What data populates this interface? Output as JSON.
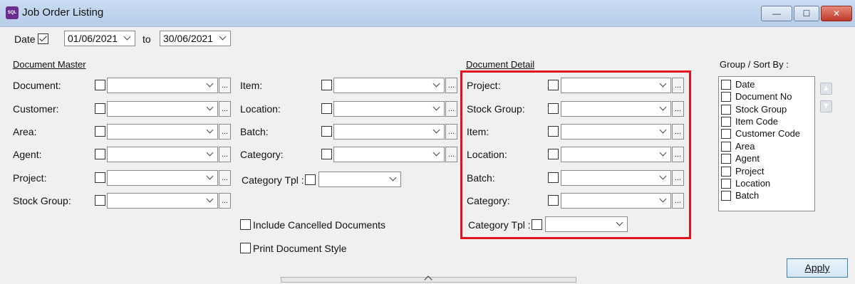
{
  "window": {
    "app_icon_text": "SQL",
    "title": "Job Order Listing",
    "minimize_glyph": "—",
    "maximize_glyph": "☐",
    "close_glyph": "✕"
  },
  "date_filter": {
    "label": "Date",
    "checked": true,
    "from": "01/06/2021",
    "to_label": "to",
    "to": "30/06/2021"
  },
  "document_master": {
    "heading": "Document Master",
    "fields": [
      {
        "label": "Document:",
        "value": ""
      },
      {
        "label": "Customer:",
        "value": ""
      },
      {
        "label": "Area:",
        "value": ""
      },
      {
        "label": "Agent:",
        "value": ""
      },
      {
        "label": "Project:",
        "value": ""
      },
      {
        "label": "Stock Group:",
        "value": ""
      }
    ]
  },
  "middle": {
    "fields": [
      {
        "label": "Item:",
        "value": ""
      },
      {
        "label": "Location:",
        "value": ""
      },
      {
        "label": "Batch:",
        "value": ""
      },
      {
        "label": "Category:",
        "value": ""
      }
    ],
    "category_tpl_label": "Category Tpl :",
    "category_tpl_value": "",
    "include_cancelled": "Include Cancelled Documents",
    "print_style": "Print Document Style"
  },
  "document_detail": {
    "heading": "Document Detail",
    "fields": [
      {
        "label": "Project:",
        "value": ""
      },
      {
        "label": "Stock Group:",
        "value": ""
      },
      {
        "label": "Item:",
        "value": ""
      },
      {
        "label": "Location:",
        "value": ""
      },
      {
        "label": "Batch:",
        "value": ""
      },
      {
        "label": "Category:",
        "value": ""
      }
    ],
    "category_tpl_label": "Category Tpl :",
    "category_tpl_value": ""
  },
  "group_sort": {
    "heading": "Group / Sort By :",
    "items": [
      "Date",
      "Document No",
      "Stock Group",
      "Item Code",
      "Customer Code",
      "Area",
      "Agent",
      "Project",
      "Location",
      "Batch"
    ],
    "move_up_glyph": "▲",
    "move_down_glyph": "▼"
  },
  "dots_glyph": "...",
  "apply_label": "Apply",
  "highlight_color": "#e0141e"
}
